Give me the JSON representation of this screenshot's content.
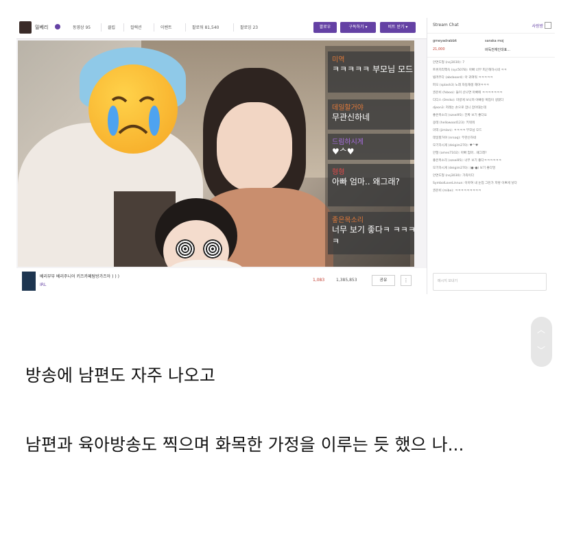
{
  "stream": {
    "channel_name": "밀베리",
    "nav_tabs": [
      "동영상 95",
      "클립",
      "컬렉션",
      "이벤트",
      "팔로워 81,540",
      "팔로잉 23"
    ],
    "buttons": [
      "팔로우",
      "구독하기 ▾",
      "비트 받기 ▾"
    ],
    "overlay_chat": [
      {
        "user": "미역",
        "text": "ㅋㅋㅋㅋㅋ 부모님 모드"
      },
      {
        "user": "데일할거야",
        "text": "무관신하네"
      },
      {
        "user": "드림하시게",
        "text": "♥ᄉ♥"
      },
      {
        "user": "형형",
        "text": "아빠 엄마.. 왜그래?"
      },
      {
        "user": "좋은목소리",
        "text": "너무 보기 좋다ㅋ ㅋㅋㅋㅋ"
      }
    ],
    "title": "베리부부 베리주니어 키즈카페탐방가즈아 ) ) )",
    "category": "IRL",
    "viewers": "1,083",
    "views": "1,385,853",
    "share_label": "공유",
    "more_label": "⋮"
  },
  "chat": {
    "header": "Stream Chat",
    "header_right": "사랑방",
    "pinned": [
      "gmeyadrabbit",
      "saraka moj",
      "21,000",
      "바둑전재인대표..."
    ],
    "lines": [
      "안면도형 (nsj3030): 7",
      "트위치리액속 (syc5078): 아빠 너무 피곤해하시네 ㅋㅋ",
      "빌려주다 (abcboard): 아 귀여워 ㅋㅋㅋㅋㅋ",
      "파오 (splash3) 노래 자동재생 해야ㅋㅋㅋ",
      "권은비 (fxboo): 들이 산나면 아빠에 ㅋㅋㅋㅋㅋㅋㅋ",
      "디디스 (0mito): 미량게 보니까 아빠랑 폭업이 생겼다",
      "djeon3: 저래는 손으로 잡니 잡아대는데",
      "좋은목소리 (szsei95): 진짜 보기 좋다요",
      "옹테 (hellowood123): 키워워",
      "미역 (jimlan): ㅋㅋㅋㅋ 부모님 모드",
      "데일할거야 (nrsoq): 무관신하네",
      "모기하시게 (deigim270): ♥ᄉ♥",
      "안형 (ames7102): 아빠 엄마.. 왜그래?",
      "좋은목소리 (szsei95): 너무 보기 좋다ㅋㅋㅋㅋㅋㅋ",
      "모기하시게 (deigim270): (●ᵕ●) 보기 좋다엉",
      "안면도형 (nsj3030): 가족이다",
      "SymbolLoveLinnun: 이아여 내 눈업 그린가 저렇 이쁘게 낳다",
      "권은비 (mibe): ㅋㅋㅋㅋㅋㅋㅋㅋㅋ"
    ],
    "input_placeholder": "메시지 보내기"
  },
  "caption": {
    "line1": "방송에 남편도 자주 나오고",
    "line2": "남편과 육아방송도 찍으며 화목한 가정을 이루는 듯 했으 나..."
  }
}
